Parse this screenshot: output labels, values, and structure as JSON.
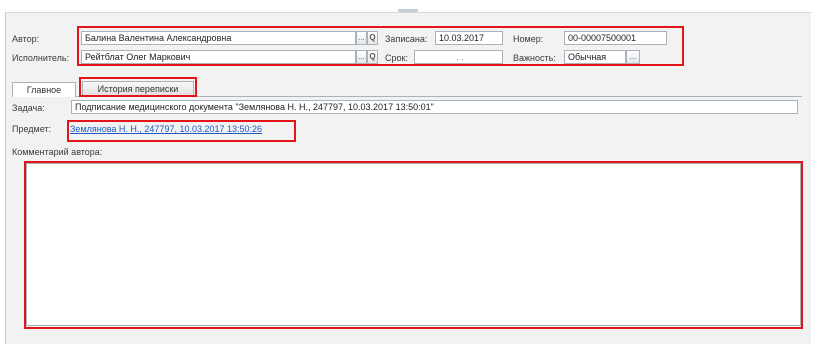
{
  "header": {
    "author_label": "Автор:",
    "author_value": "Балина Валентина Александровна",
    "executor_label": "Исполнитель:",
    "executor_value": "Рейтблат Олег Маркович",
    "written_label": "Записана:",
    "written_value": "10.03.2017",
    "deadline_label": "Срок:",
    "deadline_value": ". .",
    "number_label": "Номер:",
    "number_value": "00-00007500001",
    "importance_label": "Важность:",
    "importance_value": "Обычная",
    "select_button": "...",
    "search_icon": "Q"
  },
  "tabs": [
    {
      "label": "Главное"
    },
    {
      "label": "История переписки"
    }
  ],
  "main": {
    "task_label": "Задача:",
    "task_value": "Подписание медицинского документа \"Землянова Н. Н., 247797, 10.03.2017 13:50:01\"",
    "subject_label": "Предмет:",
    "subject_value": "Землянова Н. Н., 247797, 10.03.2017 13:50:26",
    "comment_label": "Комментарий автора:",
    "comment_value": ""
  },
  "colors": {
    "highlight": "#e3141a",
    "link": "#1a5bc4"
  }
}
